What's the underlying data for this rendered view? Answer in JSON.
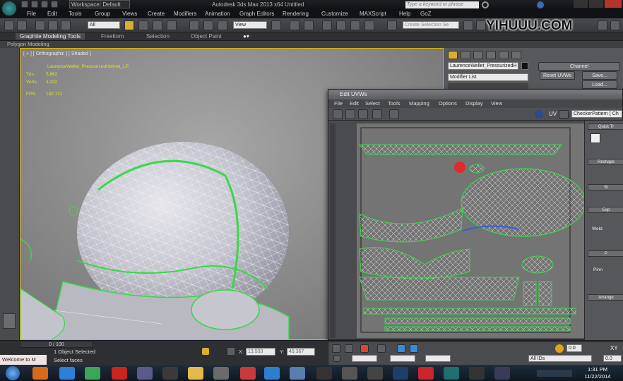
{
  "titlebar": {
    "workspace": "Workspace: Default",
    "app_title": "Autodesk 3ds Max  2013 x64     Untitled",
    "search_placeholder": "Type a keyword or phrase"
  },
  "menu": [
    "File",
    "Edit",
    "Tools",
    "Group",
    "Views",
    "Create",
    "Modifiers",
    "Animation",
    "Graph Editors",
    "Rendering",
    "Customize",
    "MAXScript",
    "Help",
    "GoZ"
  ],
  "toolbar": {
    "filter_value": "All",
    "view_value": "View",
    "selection_set_placeholder": "Create Selection Se"
  },
  "ribbon": {
    "tabs": [
      "Graphite Modeling Tools",
      "Freeform",
      "Selection",
      "Object Paint"
    ],
    "sub_label": "Polygon Modeling"
  },
  "viewport": {
    "label": "[ + ] [ Orthographic ] [ Shaded ]",
    "object_name": "LaurenceWellet_PressurizedHelmet_LP",
    "tris_label": "Tris:",
    "tris_value": "5,862",
    "verts_label": "Verts:",
    "verts_value": "3,332",
    "fps_label": "FPS:",
    "fps_value": "132.711"
  },
  "command_panel": {
    "object_name": "LaurenceWellet_PressurizedH",
    "modifier_list": "Modifier List",
    "channel_label": "Channel",
    "reset_uvws": "Reset UVWs",
    "save": "Save...",
    "load": "Load..."
  },
  "uv_editor": {
    "title": "Edit UVWs",
    "menu": [
      "File",
      "Edit",
      "Select",
      "Tools",
      "Mapping",
      "Options",
      "Display",
      "View"
    ],
    "uv_label": "UV",
    "texture_dropdown": "CheckerPattern ( Ch",
    "sections": [
      "Quick Tr",
      "Reshape",
      "St",
      "Exp",
      "Weld",
      "P",
      "Pinn",
      "Arrange"
    ],
    "bottom_value": "0.0",
    "xy_label": "XY",
    "all_ids": "All IDs",
    "zero_value": "0.0"
  },
  "statusbar": {
    "frame": "0 / 100",
    "selected": "1 Object Selected",
    "prompt": "Select faces",
    "x_label": "X:",
    "x_value": "13.533",
    "y_label": "Y:",
    "y_value": "49.367",
    "side_text": "Welcome to M"
  },
  "taskbar": {
    "time": "1:31 PM",
    "date": "11/22/2014"
  },
  "watermark": {
    "text": "YIHUUU.COM"
  },
  "colors": {
    "wire_green": "#39d84a",
    "viewport_border": "#d8b300",
    "stats_yellow": "#e0e030"
  }
}
